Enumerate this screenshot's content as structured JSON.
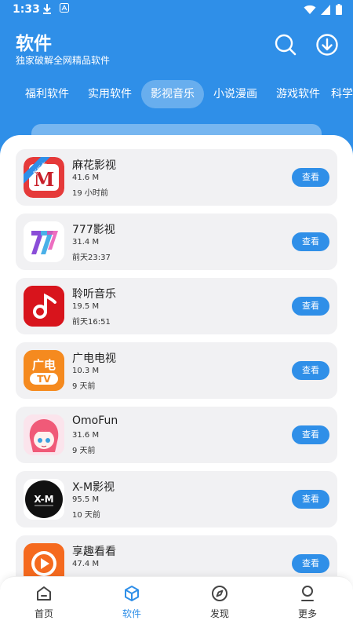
{
  "status_bar": {
    "time": "1:33"
  },
  "header": {
    "title": "软件",
    "subtitle": "独家破解全网精品软件"
  },
  "tabs": [
    {
      "label": "福利软件"
    },
    {
      "label": "实用软件"
    },
    {
      "label": "影视音乐",
      "active": true
    },
    {
      "label": "小说漫画"
    },
    {
      "label": "游戏软件"
    },
    {
      "label": "科学"
    }
  ],
  "apps": [
    {
      "name": "麻花影视",
      "size": "41.6 M",
      "time": "19 小时前",
      "badge": "新版本",
      "icon_text": "M",
      "button": "查看"
    },
    {
      "name": "777影视",
      "size": "31.4 M",
      "time": "前天23:37",
      "icon_text": "77",
      "button": "查看"
    },
    {
      "name": "聆听音乐",
      "size": "19.5 M",
      "time": "前天16:51",
      "button": "查看"
    },
    {
      "name": "广电电视",
      "size": "10.3 M",
      "time": "9 天前",
      "icon_text_top": "广电",
      "icon_text_bottom": "TV",
      "button": "查看"
    },
    {
      "name": "OmoFun",
      "size": "31.6 M",
      "time": "9 天前",
      "button": "查看"
    },
    {
      "name": "X-M影视",
      "size": "95.5 M",
      "time": "10 天前",
      "icon_text": "X-M",
      "button": "查看"
    },
    {
      "name": "享趣看看",
      "size": "47.4 M",
      "time": "",
      "button": "查看"
    }
  ],
  "bottom_nav": [
    {
      "label": "首页",
      "icon": "home-icon"
    },
    {
      "label": "软件",
      "icon": "cube-icon",
      "active": true
    },
    {
      "label": "发现",
      "icon": "compass-icon"
    },
    {
      "label": "更多",
      "icon": "user-icon"
    }
  ],
  "colors": {
    "primary": "#2f8fe8",
    "card_bg": "#f1f1f3"
  }
}
